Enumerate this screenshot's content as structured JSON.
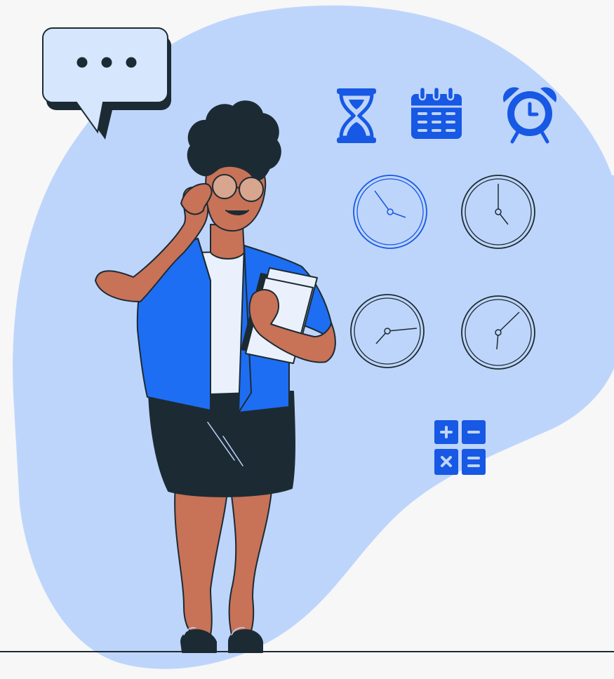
{
  "illustration": {
    "speech_bubble": {
      "dots": [
        "dot-1",
        "dot-2",
        "dot-3"
      ]
    },
    "icons": [
      "hourglass-icon",
      "calendar-icon",
      "alarm-clock-icon",
      "clock-icon",
      "calculator-icon"
    ],
    "clocks": [
      {
        "name": "clock-top-left",
        "highlighted": true
      },
      {
        "name": "clock-top-right",
        "highlighted": false
      },
      {
        "name": "clock-bottom-left",
        "highlighted": false
      },
      {
        "name": "clock-bottom-right",
        "highlighted": false
      }
    ],
    "colors": {
      "background": "#f7f7f8",
      "blob": "#bed5fb",
      "accent_blue": "#1758e4",
      "jacket_blue": "#1d6ef2",
      "outline": "#1c2b33",
      "skin": "#c87257",
      "skirt": "#1c2b33",
      "speech_bubble_fill": "#d6e6fd",
      "book_fill": "#eaf1fd"
    }
  }
}
